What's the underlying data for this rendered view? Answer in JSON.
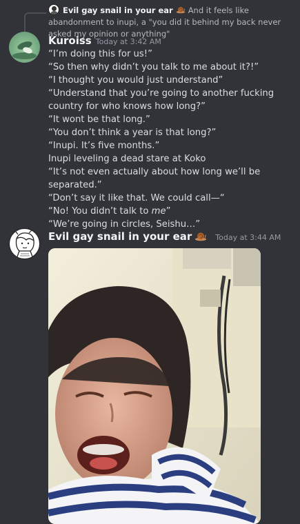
{
  "reply": {
    "author": "Evil gay snail in your ear",
    "text": "And it feels like abandonment to inupi, a \"you did it behind my back never asked my opinion or anything\""
  },
  "messages": [
    {
      "author": "Kuroiss",
      "timestamp": "Today at 3:42 AM",
      "lines": [
        "“I’m doing this for us!”",
        "“So then why didn’t you talk to me about it?!”",
        "“I thought you would just understand”",
        "“Understand that you’re going to another fucking country for who knows how long?”",
        "“It wont be that long.”",
        "“You don’t think a year is that long?”",
        "“Inupi. It’s five months.”",
        "Inupi leveling a dead stare at Koko",
        "“It’s not even actually about how long we’ll be separated.”",
        "“Don’t say it like that. We could call—“",
        "“We’re going in circles, Seishu…”"
      ],
      "line_emphasis": {
        "before": "“No! You didn’t talk to ",
        "em": "me",
        "after": "”"
      }
    },
    {
      "author": "Evil gay snail in your ear",
      "timestamp": "Today at 3:44 AM",
      "icon": "snail-emoji"
    }
  ],
  "colors": {
    "background": "#313338",
    "text": "#dbdee1",
    "author": "#f2f3f5",
    "timestamp": "#949ba4"
  }
}
